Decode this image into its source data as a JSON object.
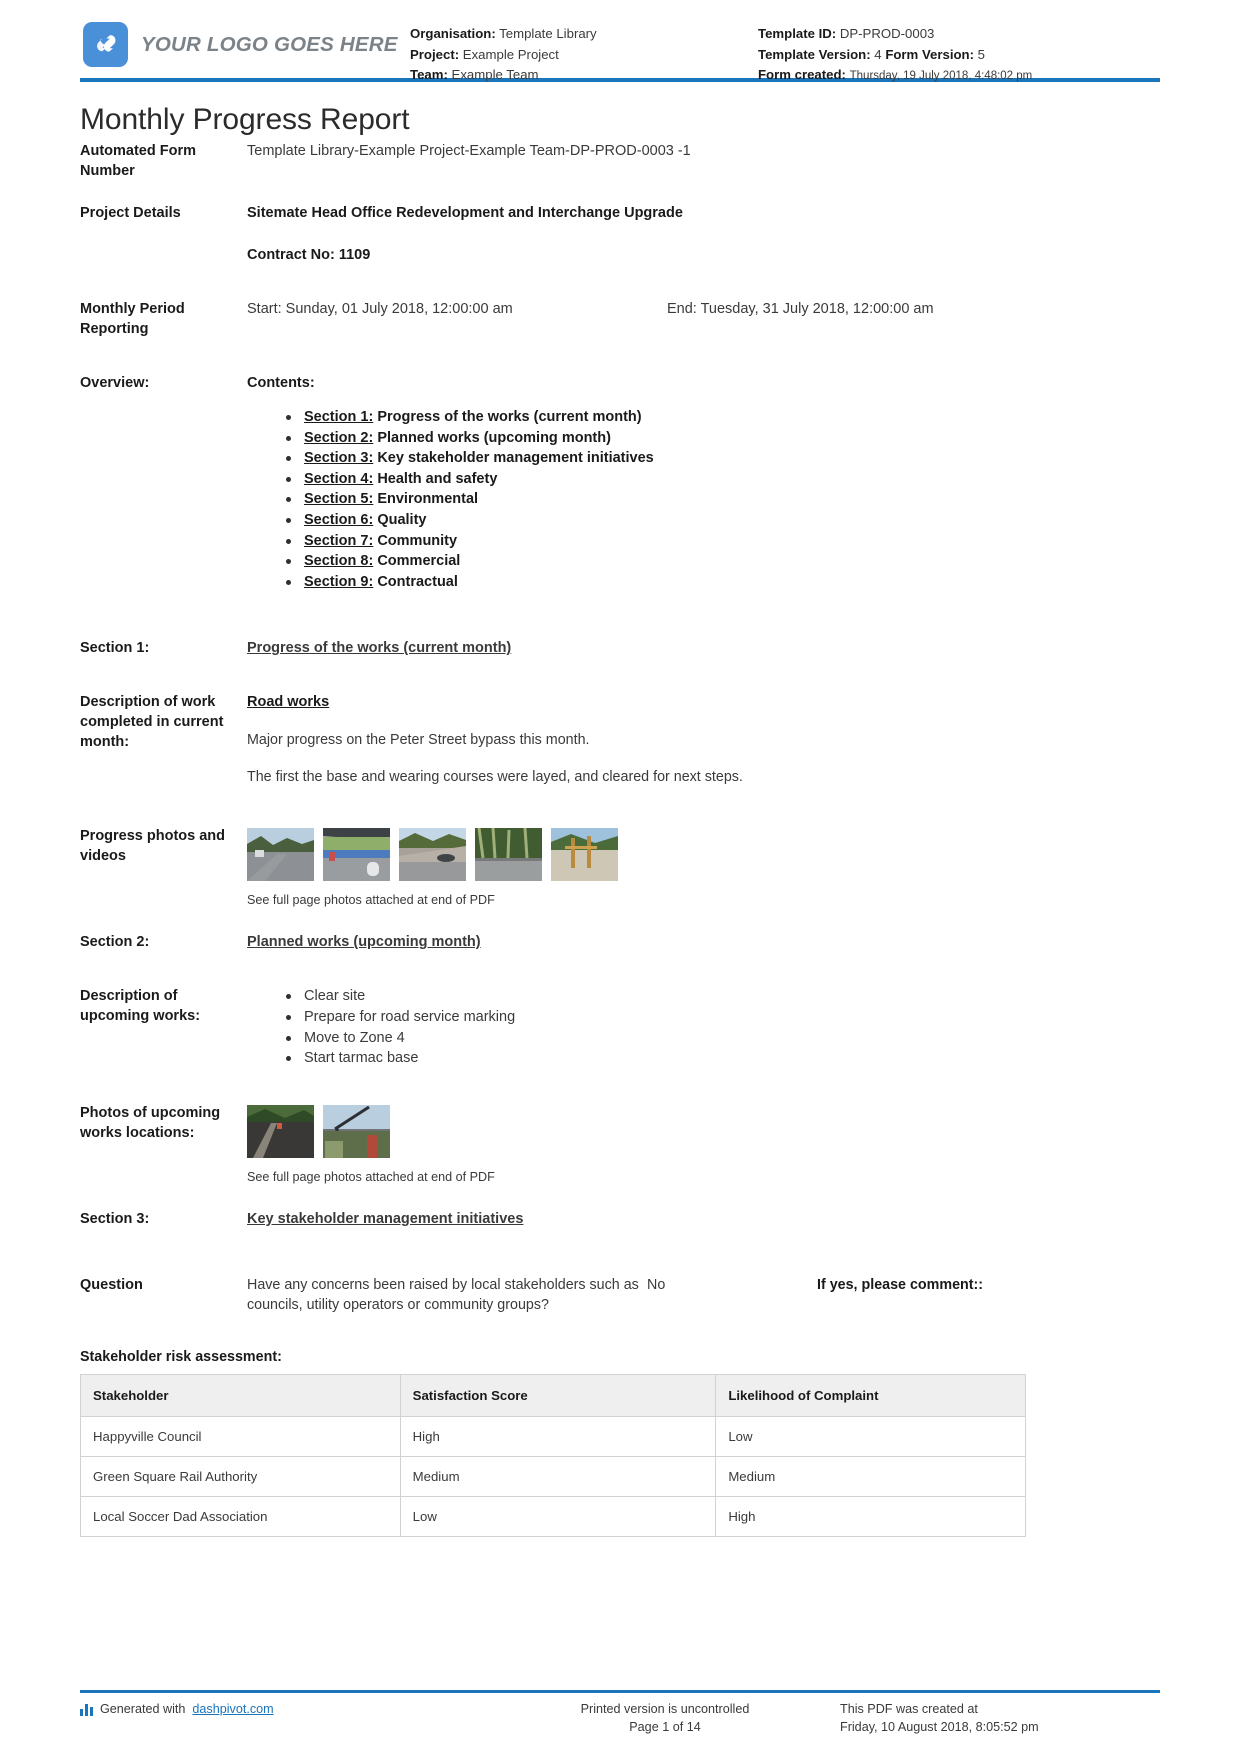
{
  "header": {
    "logo_text": "YOUR LOGO GOES HERE",
    "left": {
      "organisation_label": "Organisation:",
      "organisation_value": "Template Library",
      "project_label": "Project:",
      "project_value": "Example Project",
      "team_label": "Team:",
      "team_value": "Example Team"
    },
    "right": {
      "template_id_label": "Template ID:",
      "template_id_value": "DP-PROD-0003",
      "template_version_label": "Template Version:",
      "template_version_value": "4",
      "form_version_label": "Form Version:",
      "form_version_value": "5",
      "form_created_label": "Form created:",
      "form_created_value": "Thursday, 19 July 2018, 4:48:02 pm"
    }
  },
  "title": "Monthly Progress Report",
  "fields": {
    "form_number_label": "Automated Form Number",
    "form_number_value": "Template Library-Example Project-Example Team-DP-PROD-0003   -1",
    "project_details_label": "Project Details",
    "project_details_value": "Sitemate Head Office Redevelopment and Interchange Upgrade",
    "contract_no": "Contract No: 1109",
    "period_label": "Monthly Period Reporting",
    "period_start": "Start: Sunday, 01 July 2018, 12:00:00 am",
    "period_end": "End: Tuesday, 31 July 2018, 12:00:00 am",
    "overview_label": "Overview:",
    "contents_label": "Contents:"
  },
  "contents": [
    {
      "num": "Section 1:",
      "text": " Progress of the works (current month)"
    },
    {
      "num": "Section 2:",
      "text": " Planned works (upcoming month)"
    },
    {
      "num": "Section 3:",
      "text": " Key stakeholder management initiatives"
    },
    {
      "num": "Section 4:",
      "text": " Health and safety"
    },
    {
      "num": "Section 5:",
      "text": " Environmental"
    },
    {
      "num": "Section 6:",
      "text": " Quality"
    },
    {
      "num": "Section 7:",
      "text": " Community"
    },
    {
      "num": "Section 8:",
      "text": " Commercial"
    },
    {
      "num": "Section 9:",
      "text": " Contractual"
    }
  ],
  "section1": {
    "label": "Section 1:",
    "heading": "Progress of the works (current month)",
    "desc_label": "Description of work completed in current month:",
    "desc_heading": "Road works",
    "desc_p1": "Major progress on the Peter Street bypass this month.",
    "desc_p2": "The first the base and wearing courses were layed, and cleared for next steps.",
    "photos_label": "Progress photos and videos",
    "photos_caption": "See full page photos attached at end of PDF"
  },
  "section2": {
    "label": "Section 2:",
    "heading": "Planned works (upcoming month)",
    "desc_label": "Description of upcoming works:",
    "items": [
      "Clear site",
      "Prepare for road service marking",
      "Move to Zone 4",
      "Start tarmac base"
    ],
    "photos_label": "Photos of upcoming works locations:",
    "photos_caption": "See full page photos attached at end of PDF"
  },
  "section3": {
    "label": "Section 3:",
    "heading": "Key stakeholder management initiatives",
    "question_label": "Question",
    "question_text": "Have any concerns been raised by local stakeholders such as councils, utility operators or community groups?",
    "answer": "No",
    "comment_label": "If yes, please comment::",
    "table_title": "Stakeholder risk assessment:",
    "table": {
      "columns": [
        "Stakeholder",
        "Satisfaction Score",
        "Likelihood of Complaint"
      ],
      "rows": [
        [
          "Happyville Council",
          "High",
          "Low"
        ],
        [
          "Green Square Rail Authority",
          "Medium",
          "Medium"
        ],
        [
          "Local Soccer Dad Association",
          "Low",
          "High"
        ]
      ]
    }
  },
  "footer": {
    "generated_prefix": "Generated with ",
    "generated_link": "dashpivot.com",
    "uncontrolled": "Printed version is uncontrolled",
    "page": "Page 1 of 14",
    "created_line1": "This PDF was created at",
    "created_line2": "Friday, 10 August 2018, 8:05:52 pm"
  },
  "colors": {
    "accent": "#1b75bb",
    "logo_blue": "#4a90d9",
    "table_header_bg": "#efefef"
  }
}
